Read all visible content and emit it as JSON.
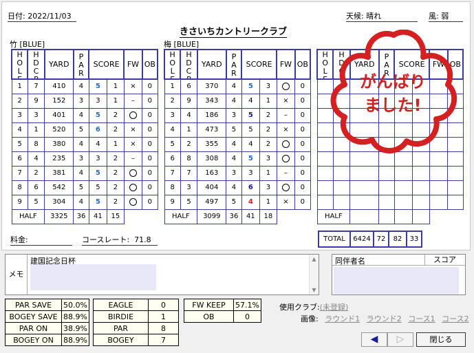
{
  "header": {
    "date_label": "日付",
    "date_value": "2022/11/03",
    "weather_label": "天候",
    "weather_value": "晴れ",
    "wind_label": "風",
    "wind_value": "弱",
    "club_name": "きさいちカントリークラブ"
  },
  "columns": {
    "hole": "HOLE",
    "hdcp": "HDCP",
    "yard": "YARD",
    "par": "PAR",
    "score": "SCORE",
    "fw": "FW",
    "ob": "OB",
    "half": "HALF",
    "total": "TOTAL"
  },
  "course1": {
    "name": "竹 [BLUE]",
    "rows": [
      {
        "hole": "1",
        "hdcp": "7",
        "yard": "410",
        "par": "4",
        "score": "5",
        "putt": "1",
        "fw": "×",
        "ob": "0",
        "score_color": "blue"
      },
      {
        "hole": "2",
        "hdcp": "9",
        "yard": "152",
        "par": "3",
        "score": "3",
        "putt": "1",
        "fw": "–",
        "ob": "0",
        "score_color": "black"
      },
      {
        "hole": "3",
        "hdcp": "3",
        "yard": "401",
        "par": "4",
        "score": "5",
        "putt": "2",
        "fw": "○",
        "ob": "0",
        "score_color": "blue"
      },
      {
        "hole": "4",
        "hdcp": "1",
        "yard": "520",
        "par": "5",
        "score": "6",
        "putt": "2",
        "fw": "×",
        "ob": "0",
        "score_color": "blue"
      },
      {
        "hole": "5",
        "hdcp": "8",
        "yard": "380",
        "par": "4",
        "score": "4",
        "putt": "1",
        "fw": "×",
        "ob": "0",
        "score_color": "black"
      },
      {
        "hole": "6",
        "hdcp": "4",
        "yard": "235",
        "par": "3",
        "score": "3",
        "putt": "2",
        "fw": "–",
        "ob": "0",
        "score_color": "black"
      },
      {
        "hole": "7",
        "hdcp": "2",
        "yard": "381",
        "par": "4",
        "score": "5",
        "putt": "2",
        "fw": "○",
        "ob": "0",
        "score_color": "blue"
      },
      {
        "hole": "8",
        "hdcp": "6",
        "yard": "542",
        "par": "5",
        "score": "5",
        "putt": "2",
        "fw": "○",
        "ob": "0",
        "score_color": "black"
      },
      {
        "hole": "9",
        "hdcp": "5",
        "yard": "304",
        "par": "4",
        "score": "5",
        "putt": "2",
        "fw": "○",
        "ob": "0",
        "score_color": "blue"
      }
    ],
    "half": {
      "yard": "3325",
      "par": "36",
      "score": "41",
      "putt": "15"
    }
  },
  "course2": {
    "name": "梅 [BLUE]",
    "rows": [
      {
        "hole": "1",
        "hdcp": "6",
        "yard": "370",
        "par": "4",
        "score": "5",
        "putt": "3",
        "fw": "○",
        "ob": "0",
        "score_color": "blue"
      },
      {
        "hole": "2",
        "hdcp": "9",
        "yard": "343",
        "par": "4",
        "score": "4",
        "putt": "1",
        "fw": "×",
        "ob": "0",
        "score_color": "black"
      },
      {
        "hole": "3",
        "hdcp": "4",
        "yard": "186",
        "par": "3",
        "score": "5",
        "putt": "2",
        "fw": "–",
        "ob": "0",
        "score_color": "dblue"
      },
      {
        "hole": "4",
        "hdcp": "1",
        "yard": "473",
        "par": "5",
        "score": "5",
        "putt": "2",
        "fw": "×",
        "ob": "0",
        "score_color": "black"
      },
      {
        "hole": "5",
        "hdcp": "2",
        "yard": "355",
        "par": "4",
        "score": "4",
        "putt": "2",
        "fw": "○",
        "ob": "0",
        "score_color": "black"
      },
      {
        "hole": "6",
        "hdcp": "8",
        "yard": "308",
        "par": "4",
        "score": "5",
        "putt": "3",
        "fw": "○",
        "ob": "0",
        "score_color": "blue"
      },
      {
        "hole": "7",
        "hdcp": "7",
        "yard": "163",
        "par": "3",
        "score": "3",
        "putt": "1",
        "fw": "–",
        "ob": "0",
        "score_color": "black"
      },
      {
        "hole": "8",
        "hdcp": "3",
        "yard": "404",
        "par": "4",
        "score": "6",
        "putt": "3",
        "fw": "○",
        "ob": "0",
        "score_color": "dblue"
      },
      {
        "hole": "9",
        "hdcp": "5",
        "yard": "497",
        "par": "5",
        "score": "4",
        "putt": "1",
        "fw": "×",
        "ob": "0",
        "score_color": "red"
      }
    ],
    "half": {
      "yard": "3099",
      "par": "36",
      "score": "41",
      "putt": "18"
    }
  },
  "total": {
    "yard": "6424",
    "par": "72",
    "score": "82",
    "putt": "33"
  },
  "stamp_text": [
    "がんばり",
    "ました!"
  ],
  "footer": {
    "fee_label": "料金:",
    "course_rate_label": "コースレート:",
    "course_rate_value": "71.8"
  },
  "memo": {
    "label": "メモ",
    "text": "建国記念日杯"
  },
  "companions": {
    "name_header": "同伴者名",
    "score_header": "スコア"
  },
  "stats_left": [
    {
      "label": "PAR SAVE",
      "value": "50.0%"
    },
    {
      "label": "BOGEY SAVE",
      "value": "88.9%"
    },
    {
      "label": "PAR ON",
      "value": "38.9%"
    },
    {
      "label": "BOGEY ON",
      "value": "88.9%"
    }
  ],
  "stats_mid": [
    {
      "label": "EAGLE",
      "value": "0"
    },
    {
      "label": "BIRDIE",
      "value": "1"
    },
    {
      "label": "PAR",
      "value": "8"
    },
    {
      "label": "BOGEY",
      "value": "7"
    }
  ],
  "stats_right": [
    {
      "label": "FW KEEP",
      "value": "57.1%"
    },
    {
      "label": "OB",
      "value": "0"
    }
  ],
  "club_use": {
    "label": "使用クラブ:",
    "value": "(未登録)"
  },
  "images": {
    "label": "画像:",
    "items": [
      "ラウンド1",
      "ラウンド2",
      "コース1",
      "コース2"
    ]
  },
  "buttons": {
    "prev": "◀",
    "next": "▷",
    "close": "閉じる"
  },
  "colors": {
    "grid": "#3c3ca0",
    "score_blue": "#1e6ec8",
    "score_dblue": "#1a1a9a",
    "score_red": "#e02020",
    "stamp_red": "#d42020"
  }
}
